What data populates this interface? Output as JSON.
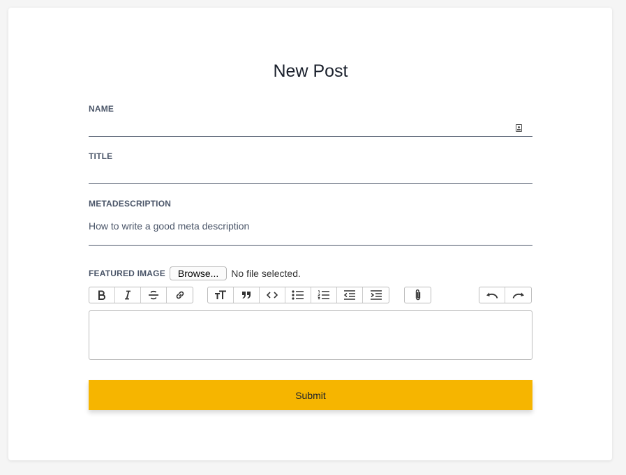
{
  "form": {
    "title": "New Post",
    "name": {
      "label": "NAME",
      "value": ""
    },
    "title_field": {
      "label": "TITLE",
      "value": ""
    },
    "metadescription": {
      "label": "METADESCRIPTION",
      "value": "How to write a good meta description"
    },
    "featured_image": {
      "label": "FEATURED IMAGE",
      "browse_label": "Browse...",
      "status": "No file selected."
    },
    "editor": {
      "value": ""
    },
    "submit_label": "Submit"
  },
  "toolbar": {
    "groups": [
      [
        "bold-icon",
        "italic-icon",
        "strikethrough-icon",
        "link-icon"
      ],
      [
        "heading-icon",
        "quote-icon",
        "code-icon",
        "bullet-list-icon",
        "numbered-list-icon",
        "decrease-indent-icon",
        "increase-indent-icon"
      ],
      [
        "attach-icon"
      ],
      [
        "undo-icon",
        "redo-icon"
      ]
    ]
  },
  "colors": {
    "accent": "#f6b500",
    "background": "#f5f5f5",
    "card": "#ffffff",
    "text": "#4a5568"
  }
}
